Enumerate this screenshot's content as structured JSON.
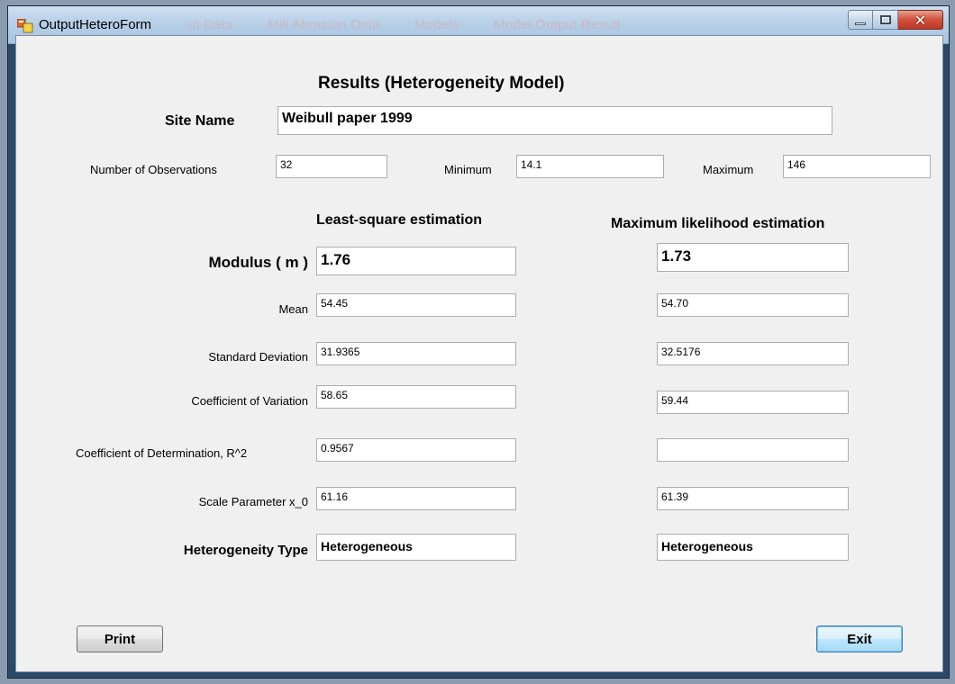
{
  "window": {
    "title": "OutputHeteroForm",
    "background_tabs": [
      "ut Data",
      "Mill Abrasion Data",
      "Models",
      "Model Output Result"
    ]
  },
  "form": {
    "heading": "Results (Heterogeneity Model)",
    "site_name_label": "Site Name",
    "site_name_value": "Weibull paper 1999",
    "observations_label": "Number of Observations",
    "observations_value": "32",
    "minimum_label": "Minimum",
    "minimum_value": "14.1",
    "maximum_label": "Maximum",
    "maximum_value": "146",
    "col_lsq_header": "Least-square estimation",
    "col_mle_header": "Maximum likelihood estimation",
    "rows": {
      "modulus": {
        "label": "Modulus  ( m )",
        "lsq": "1.76",
        "mle": "1.73"
      },
      "mean": {
        "label": "Mean",
        "lsq": "54.45",
        "mle": "54.70"
      },
      "std": {
        "label": "Standard Deviation",
        "lsq": "31.9365",
        "mle": "32.5176"
      },
      "cv": {
        "label": "Coefficient of Variation",
        "lsq": "58.65",
        "mle": "59.44"
      },
      "r2": {
        "label": "Coefficient of Determination, R^2",
        "lsq": "0.9567",
        "mle": ""
      },
      "scale": {
        "label": "Scale Parameter x_0",
        "lsq": "61.16",
        "mle": "61.39"
      },
      "hetero": {
        "label": "Heterogeneity Type",
        "lsq": "Heterogeneous",
        "mle": "Heterogeneous"
      }
    },
    "print_label": "Print",
    "exit_label": "Exit"
  },
  "icons": {
    "app": "form-app-icon",
    "minimize": "minimize-icon",
    "maximize": "maximize-icon",
    "close": "close-icon"
  },
  "colors": {
    "titlebar": "#b7cfe8",
    "client_bg": "#f0f0f0",
    "close_button": "#c03828"
  }
}
